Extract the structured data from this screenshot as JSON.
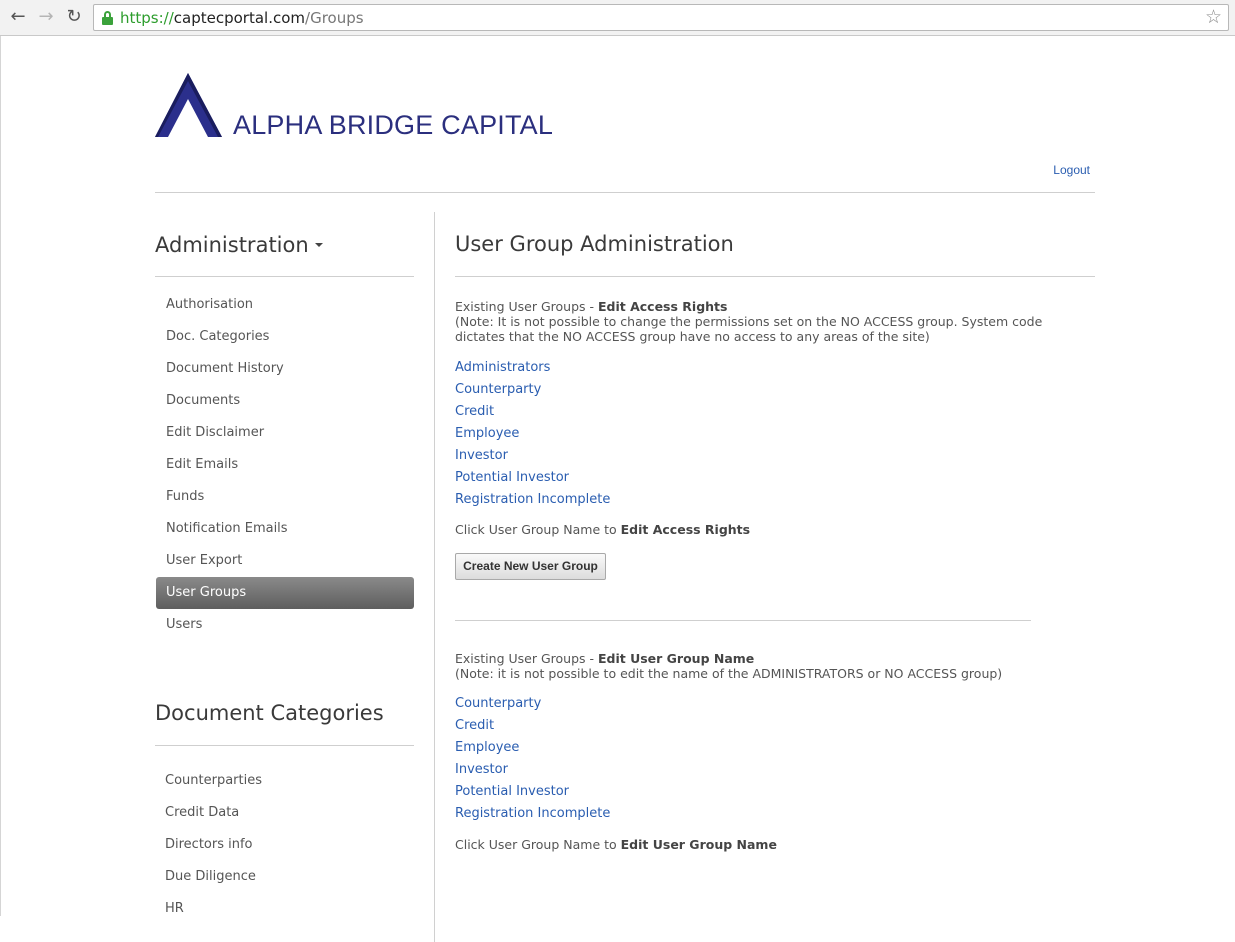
{
  "browser": {
    "url_scheme": "https://",
    "url_host": "captecportal.com",
    "url_path": "/Groups",
    "back_icon": "back-arrow-icon",
    "forward_icon": "forward-arrow-icon",
    "reload_icon": "reload-icon",
    "star_icon": "bookmark-star-icon",
    "lock_color": "#3ba23b"
  },
  "header": {
    "brand": "ALPHA BRIDGE CAPITAL",
    "brand_color": "#2b2f7e",
    "logout": "Logout"
  },
  "sidebar": {
    "admin_heading": "Administration",
    "admin_items": [
      {
        "label": "Authorisation"
      },
      {
        "label": "Doc. Categories"
      },
      {
        "label": "Document History"
      },
      {
        "label": "Documents"
      },
      {
        "label": "Edit Disclaimer"
      },
      {
        "label": "Edit Emails"
      },
      {
        "label": "Funds"
      },
      {
        "label": "Notification Emails"
      },
      {
        "label": "User Export"
      },
      {
        "label": "User Groups"
      },
      {
        "label": "Users"
      }
    ],
    "active_item": "User Groups",
    "docs_heading": "Document Categories",
    "doc_items": [
      {
        "label": "Counterparties"
      },
      {
        "label": "Credit Data"
      },
      {
        "label": "Directors info"
      },
      {
        "label": "Due Diligence"
      },
      {
        "label": "HR"
      }
    ]
  },
  "main": {
    "title": "User Group Administration",
    "section1": {
      "lead": "Existing User Groups - ",
      "lead_bold": "Edit Access Rights",
      "note": "(Note: It is not possible to change the permissions set on the NO ACCESS group. System code dictates that the NO ACCESS group have no access to any areas of the site)",
      "groups": [
        "Administrators",
        "Counterparty",
        "Credit",
        "Employee",
        "Investor",
        "Potential Investor",
        "Registration Incomplete"
      ],
      "hint": "Click User Group Name to ",
      "hint_bold": "Edit Access Rights",
      "create_button": "Create New User Group"
    },
    "section2": {
      "lead": "Existing User Groups - ",
      "lead_bold": "Edit User Group Name",
      "note": "(Note: it is not possible to edit the name of the ADMINISTRATORS or NO ACCESS group)",
      "groups": [
        "Counterparty",
        "Credit",
        "Employee",
        "Investor",
        "Potential Investor",
        "Registration Incomplete"
      ],
      "hint": "Click User Group Name to ",
      "hint_bold": "Edit User Group Name"
    },
    "link_color": "#2a5db0"
  }
}
